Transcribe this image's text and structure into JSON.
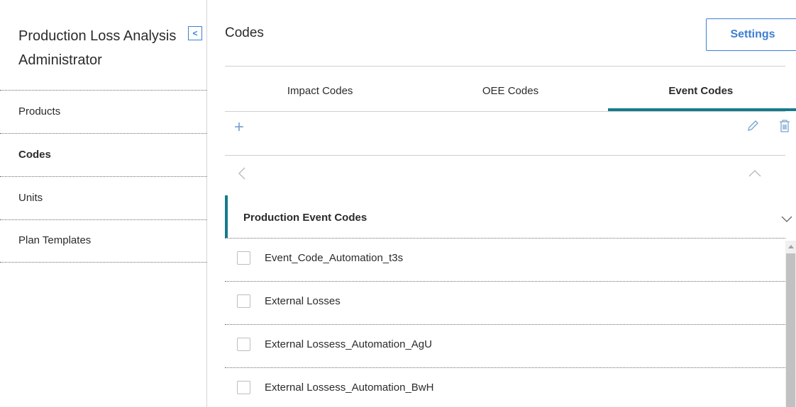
{
  "sidebar": {
    "title_line1": "Production Loss Analysis",
    "title_line2": "Administrator",
    "collapse_icon": "chevron-left-icon",
    "items": [
      {
        "label": "Products",
        "active": false
      },
      {
        "label": "Codes",
        "active": true
      },
      {
        "label": "Units",
        "active": false
      },
      {
        "label": "Plan Templates",
        "active": false
      }
    ]
  },
  "main": {
    "title": "Codes",
    "settings_label": "Settings",
    "tabs": [
      {
        "label": "Impact Codes",
        "active": false
      },
      {
        "label": "OEE Codes",
        "active": false
      },
      {
        "label": "Event Codes",
        "active": true
      }
    ],
    "toolbar": {
      "add_icon": "plus-icon",
      "edit_icon": "pencil-icon",
      "delete_icon": "trash-icon"
    },
    "group": {
      "title": "Production Event Codes",
      "rows": [
        {
          "label": "Event_Code_Automation_t3s"
        },
        {
          "label": "External Losses"
        },
        {
          "label": "External Lossess_Automation_AgU"
        },
        {
          "label": "External Lossess_Automation_BwH"
        }
      ]
    }
  },
  "colors": {
    "accent": "#3d7fd1",
    "tab_indicator": "#167a8c",
    "text": "#2b2b2b"
  }
}
